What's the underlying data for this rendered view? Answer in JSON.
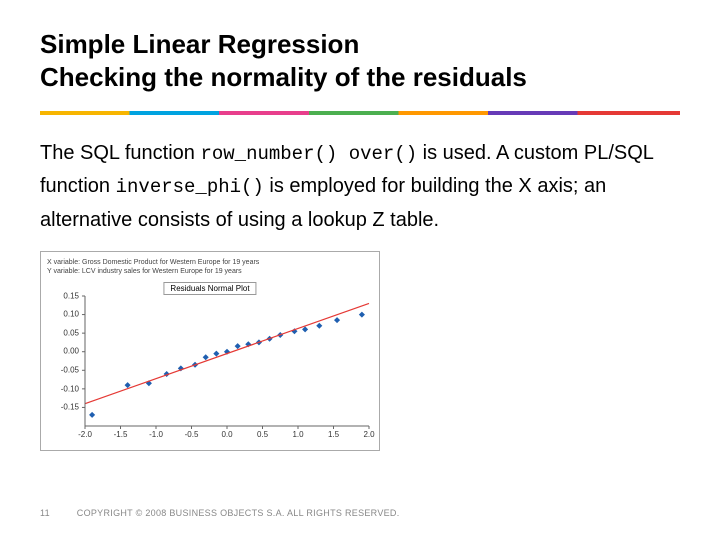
{
  "title_line1": "Simple Linear Regression",
  "title_line2": "Checking the normality of the residuals",
  "body": {
    "p1a": "The SQL function ",
    "code1": "row_number() over()",
    "p1b": " is used. A custom PL/SQL function ",
    "code2": "inverse_phi()",
    "p1c": " is employed for building the X axis; an alternative consists of using a lookup Z table."
  },
  "chart_meta": {
    "line1": "X variable: Gross Domestic Product for Western Europe for 19 years",
    "line2": "Y variable: LCV industry sales for Western Europe for 19 years"
  },
  "chart_title": "Residuals Normal Plot",
  "footer": {
    "page": "11",
    "copyright": "COPYRIGHT © 2008 BUSINESS OBJECTS S.A.  ALL RIGHTS RESERVED."
  },
  "chart_data": {
    "type": "scatter",
    "title": "Residuals Normal Plot",
    "xlabel": "",
    "ylabel": "",
    "xlim": [
      -2.0,
      2.0
    ],
    "ylim": [
      -0.2,
      0.15
    ],
    "x_ticks": [
      -2.0,
      -1.5,
      -1.0,
      -0.5,
      0.0,
      0.5,
      1.0,
      1.5,
      2.0
    ],
    "y_ticks": [
      0.15,
      0.1,
      0.05,
      0.0,
      -0.05,
      -0.1,
      -0.15
    ],
    "series": [
      {
        "name": "residuals",
        "type": "scatter",
        "color": "#1f5fb0",
        "x": [
          -1.9,
          -1.4,
          -1.1,
          -0.85,
          -0.65,
          -0.45,
          -0.3,
          -0.15,
          0.0,
          0.15,
          0.3,
          0.45,
          0.6,
          0.75,
          0.95,
          1.1,
          1.3,
          1.55,
          1.9
        ],
        "y": [
          -0.17,
          -0.09,
          -0.085,
          -0.06,
          -0.045,
          -0.035,
          -0.015,
          -0.005,
          0.0,
          0.015,
          0.02,
          0.025,
          0.035,
          0.045,
          0.055,
          0.06,
          0.07,
          0.085,
          0.1
        ]
      },
      {
        "name": "fit",
        "type": "line",
        "color": "#e53935",
        "x": [
          -2.0,
          2.0
        ],
        "y": [
          -0.14,
          0.13
        ]
      }
    ]
  }
}
